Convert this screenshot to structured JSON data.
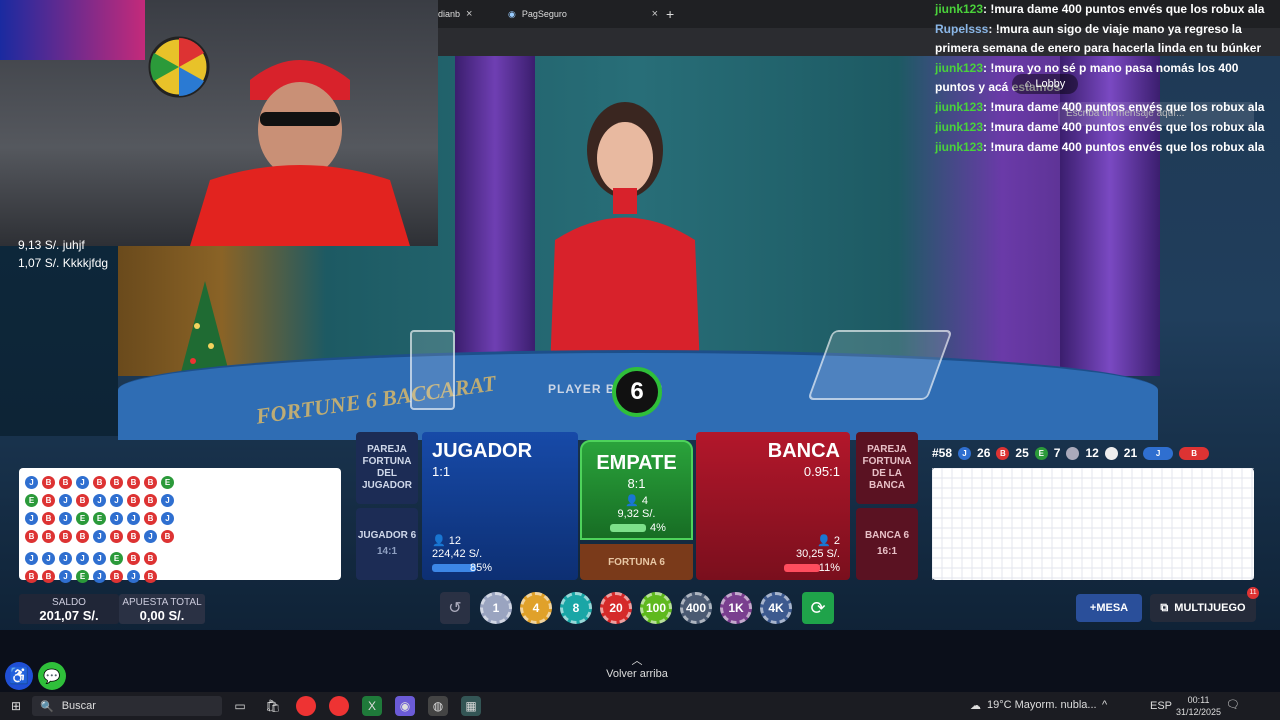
{
  "browser": {
    "tabs": [
      {
        "label": "dianb"
      },
      {
        "label": "PagSeguro"
      }
    ],
    "new_tab": "+",
    "close": "×"
  },
  "stream": {
    "donations": [
      "9,13 S/. juhjf",
      "1,07 S/. Kkkkjfdg"
    ],
    "chat_placeholder": "Escriba un mensaje aquí...",
    "chat": [
      {
        "user": "jiunk123",
        "text": ": !mura dame 400 puntos envés que los robux ala",
        "color": "green"
      },
      {
        "user": "Rupelsss",
        "text": ": !mura aun sigo de viaje mano ya regreso la primera semana de enero para hacerla linda en tu búnker",
        "color": "blue"
      },
      {
        "user": "jiunk123",
        "text": ": !mura yo no sé p mano pasa nomás los 400 puntos y acá estamos",
        "color": "green"
      },
      {
        "user": "jiunk123",
        "text": ": !mura dame 400 puntos envés que los robux ala",
        "color": "green"
      },
      {
        "user": "jiunk123",
        "text": ": !mura dame 400 puntos envés que los robux ala",
        "color": "green"
      },
      {
        "user": "jiunk123",
        "text": ": !mura dame 400 puntos envés que los robux ala",
        "color": "green"
      }
    ],
    "lobby": "Lobby"
  },
  "game": {
    "countdown": "6",
    "table_logo": "FORTUNE 6 BACCARAT",
    "table_line": "PLAYER    BANKER",
    "colors": {
      "player": "#174aa8",
      "banker": "#b3172b",
      "tie": "#2aa33b"
    },
    "jugador": {
      "title": "JUGADOR",
      "odds": "1:1",
      "players": "12",
      "amount": "224,42 S/.",
      "pct": "85%",
      "pct_value": 85
    },
    "banca": {
      "title": "BANCA",
      "odds": "0.95:1",
      "players": "2",
      "amount": "30,25 S/.",
      "pct": "11%",
      "pct_value": 11
    },
    "empate": {
      "title": "EMPATE",
      "odds": "8:1",
      "players": "4",
      "amount": "9,32 S/.",
      "pct": "4%",
      "pct_value": 4
    },
    "fortuna": "FORTUNA 6",
    "pareja_jugador": "PAREJA FORTUNA DEL JUGADOR",
    "pareja_banca": "PAREJA FORTUNA DE LA BANCA",
    "jugador6": {
      "label": "JUGADOR 6",
      "odds": "14:1"
    },
    "banca6": {
      "label": "BANCA 6",
      "odds": "16:1"
    },
    "stats": {
      "round": "#58",
      "p_label": "J",
      "p": "26",
      "b_label": "B",
      "b": "25",
      "e_label": "E",
      "e": "7",
      "pairs_p": "12",
      "pairs_b": "21",
      "ask_j": "J",
      "ask_b": "B"
    },
    "bead_road": [
      [
        "J",
        "B",
        "B",
        "J",
        "B",
        "B",
        "B",
        "B",
        "E"
      ],
      [
        "E",
        "B",
        "J",
        "B",
        "J",
        "J",
        "B",
        "B",
        "J"
      ],
      [
        "J",
        "B",
        "J",
        "E",
        "E",
        "J",
        "J",
        "B",
        "J"
      ],
      [
        "B",
        "B",
        "B",
        "B",
        "J",
        "B",
        "B",
        "J",
        "B"
      ],
      [
        "J",
        "J",
        "J",
        "J",
        "J",
        "E",
        "B",
        "B",
        ""
      ],
      [
        "B",
        "B",
        "J",
        "E",
        "J",
        "B",
        "J",
        "B",
        ""
      ]
    ]
  },
  "footer": {
    "saldo_label": "SALDO",
    "saldo": "201,07 S/.",
    "apuesta_label": "APUESTA TOTAL",
    "apuesta": "0,00 S/.",
    "chips": [
      {
        "value": "1",
        "color": "#9aa4c0"
      },
      {
        "value": "4",
        "color": "#e0a12a"
      },
      {
        "value": "8",
        "color": "#1aa6a6"
      },
      {
        "value": "20",
        "color": "#d52a2a"
      },
      {
        "value": "100",
        "color": "#5fb91e"
      },
      {
        "value": "400",
        "color": "#4b5a72"
      },
      {
        "value": "1K",
        "color": "#7a3f8f"
      },
      {
        "value": "4K",
        "color": "#3d5a8f"
      }
    ],
    "mesa": "+MESA",
    "multijuego": "MULTIJUEGO",
    "multijuego_badge": "11",
    "volver": "Volver arriba"
  },
  "taskbar": {
    "search": "Buscar",
    "weather": "19°C  Mayorm. nubla...",
    "lang": "ESP",
    "time": "00:11",
    "date": "31/12/2025"
  }
}
